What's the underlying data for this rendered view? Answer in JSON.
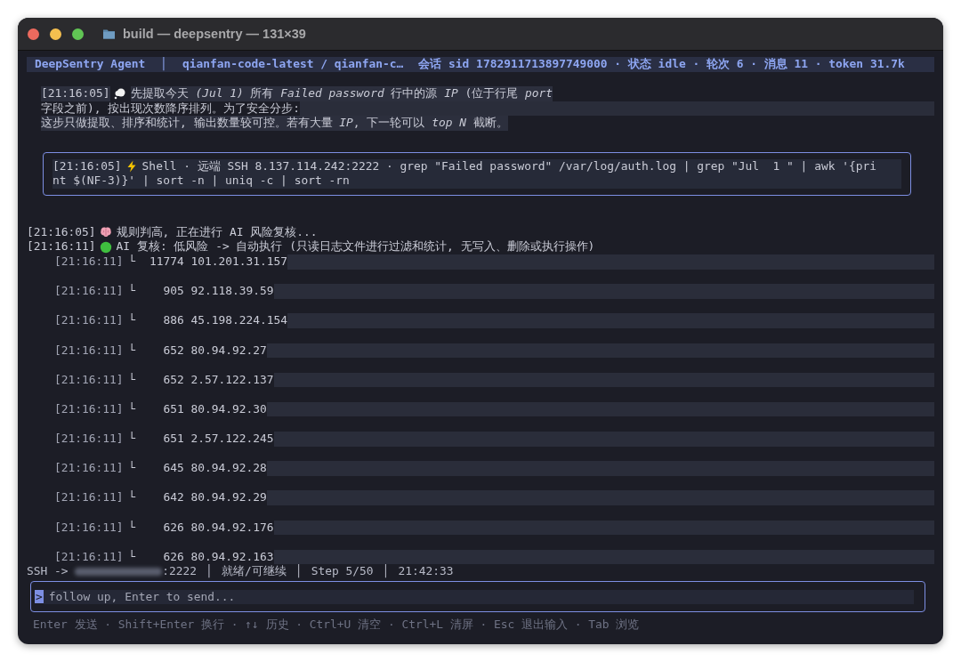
{
  "window": {
    "title": "build — deepsentry — 131×39"
  },
  "header": {
    "app": "DeepSentry Agent",
    "separator": "│",
    "model": "qianfan-code-latest / qianfan-c…",
    "session": "会话 sid 1782911713897749000 · 状态 idle · 轮次 6 · 消息 11 · token 31.7k"
  },
  "log": [
    {
      "kind": "thought",
      "time": "[21:16:05]",
      "lines": [
        "先提取今天 *(Jul 1)* 所有 *Failed password* 行中的源 *IP* (位于行尾 *port*",
        "字段之前), 按出现次数降序排列。为了安全分步:",
        "这步只做提取、排序和统计, 输出数量较可控。若有大量 *IP*, 下一轮可以 *top N* 截断。"
      ]
    },
    {
      "kind": "command",
      "time": "[21:16:05]",
      "lines": [
        "Shell · 远端 SSH 8.137.114.242:2222 · grep \"Failed password\" /var/log/auth.log | grep \"Jul  1 \" | awk '{pri",
        "nt $(NF-3)}' | sort -n | uniq -c | sort -rn"
      ]
    },
    {
      "kind": "review",
      "time": "[21:16:05]",
      "lines": [
        "规则判高, 正在进行 AI 风险复核..."
      ]
    },
    {
      "kind": "verdict",
      "time": "[21:16:11]",
      "lines": [
        "AI 复核: 低风险 -> 自动执行 (只读日志文件进行过滤和统计, 无写入、删除或执行操作)"
      ]
    },
    {
      "kind": "result",
      "time": "[21:16:11]",
      "branch": "└",
      "count": "11774",
      "ip": "101.201.31.157"
    },
    {
      "kind": "result",
      "time": "[21:16:11]",
      "branch": "└",
      "count": "905",
      "ip": "92.118.39.59"
    },
    {
      "kind": "result",
      "time": "[21:16:11]",
      "branch": "└",
      "count": "886",
      "ip": "45.198.224.154"
    },
    {
      "kind": "result",
      "time": "[21:16:11]",
      "branch": "└",
      "count": "652",
      "ip": "80.94.92.27"
    },
    {
      "kind": "result",
      "time": "[21:16:11]",
      "branch": "└",
      "count": "652",
      "ip": "2.57.122.137"
    },
    {
      "kind": "result",
      "time": "[21:16:11]",
      "branch": "└",
      "count": "651",
      "ip": "80.94.92.30"
    },
    {
      "kind": "result",
      "time": "[21:16:11]",
      "branch": "└",
      "count": "651",
      "ip": "2.57.122.245"
    },
    {
      "kind": "result",
      "time": "[21:16:11]",
      "branch": "└",
      "count": "645",
      "ip": "80.94.92.28"
    },
    {
      "kind": "result",
      "time": "[21:16:11]",
      "branch": "└",
      "count": "642",
      "ip": "80.94.92.29"
    },
    {
      "kind": "result",
      "time": "[21:16:11]",
      "branch": "└",
      "count": "626",
      "ip": "80.94.92.176"
    },
    {
      "kind": "result",
      "time": "[21:16:11]",
      "branch": "└",
      "count": "626",
      "ip": "80.94.92.163"
    }
  ],
  "status_bar": {
    "ssh_label": "SSH ->",
    "port": ":2222",
    "separator": "│",
    "state": "就绪/可继续",
    "step": "Step 5/50",
    "clock": "21:42:33"
  },
  "input": {
    "prompt": ">",
    "placeholder": "follow up, Enter to send..."
  },
  "hints": {
    "separator": "·",
    "items": [
      "Enter 发送",
      "Shift+Enter 换行",
      "↑↓ 历史",
      "Ctrl+U 清空",
      "Ctrl+L 清屏",
      "Esc 退出输入",
      "Tab 浏览"
    ]
  }
}
